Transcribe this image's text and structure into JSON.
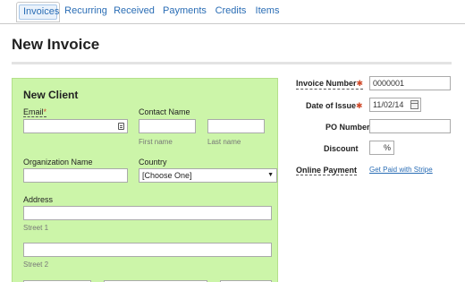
{
  "tabs": [
    {
      "label": "Invoices",
      "active": true
    },
    {
      "label": "Recurring"
    },
    {
      "label": "Received"
    },
    {
      "label": "Payments"
    },
    {
      "label": "Credits"
    },
    {
      "label": "Items"
    }
  ],
  "page": {
    "title": "New Invoice"
  },
  "client": {
    "title": "New Client",
    "email_label": "Email",
    "required_mark": "*",
    "contact_name_label": "Contact Name",
    "first_name_hint": "First name",
    "last_name_hint": "Last name",
    "organization_label": "Organization Name",
    "country_label": "Country",
    "country_value": "[Choose One]",
    "address_label": "Address",
    "street1_hint": "Street 1",
    "street2_hint": "Street 2"
  },
  "invoice": {
    "number_label": "Invoice Number",
    "number_value": "0000001",
    "date_label": "Date of Issue",
    "date_value": "11/02/14",
    "po_label": "PO Number",
    "discount_label": "Discount",
    "discount_unit": "%",
    "online_payment_label": "Online Payment",
    "stripe_link": "Get Paid with Stripe",
    "required_mark": "✱"
  },
  "colors": {
    "client_bg": "#ccf5a9",
    "link": "#2a6db5",
    "required": "#d04a2a"
  },
  "icons": [
    "contact-card-icon",
    "calendar-icon",
    "dropdown-arrow-icon"
  ]
}
